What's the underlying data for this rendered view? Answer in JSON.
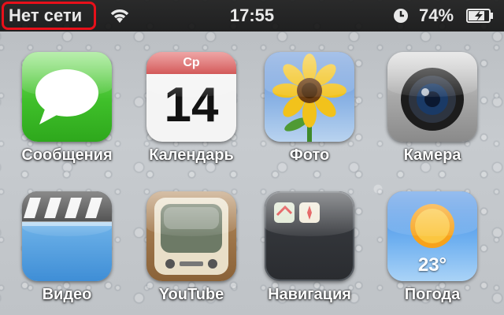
{
  "status_bar": {
    "carrier": "Нет сети",
    "time": "17:55",
    "battery_percent": "74%",
    "icons": [
      "wifi-icon",
      "alarm-clock-icon",
      "battery-charging-icon"
    ],
    "highlight_color": "#e8101a"
  },
  "apps": [
    {
      "label": "Сообщения",
      "icon": "messages-icon"
    },
    {
      "label": "Календарь",
      "icon": "calendar-icon",
      "weekday": "Ср",
      "day": "14"
    },
    {
      "label": "Фото",
      "icon": "photos-sunflower-icon"
    },
    {
      "label": "Камера",
      "icon": "camera-icon"
    },
    {
      "label": "Видео",
      "icon": "video-clapperboard-icon"
    },
    {
      "label": "YouTube",
      "icon": "youtube-tv-icon"
    },
    {
      "label": "Навигация",
      "icon": "folder-icon",
      "folder_items": [
        "maps-icon",
        "compass-icon"
      ]
    },
    {
      "label": "Погода",
      "icon": "weather-sun-icon",
      "temperature": "23°"
    }
  ]
}
